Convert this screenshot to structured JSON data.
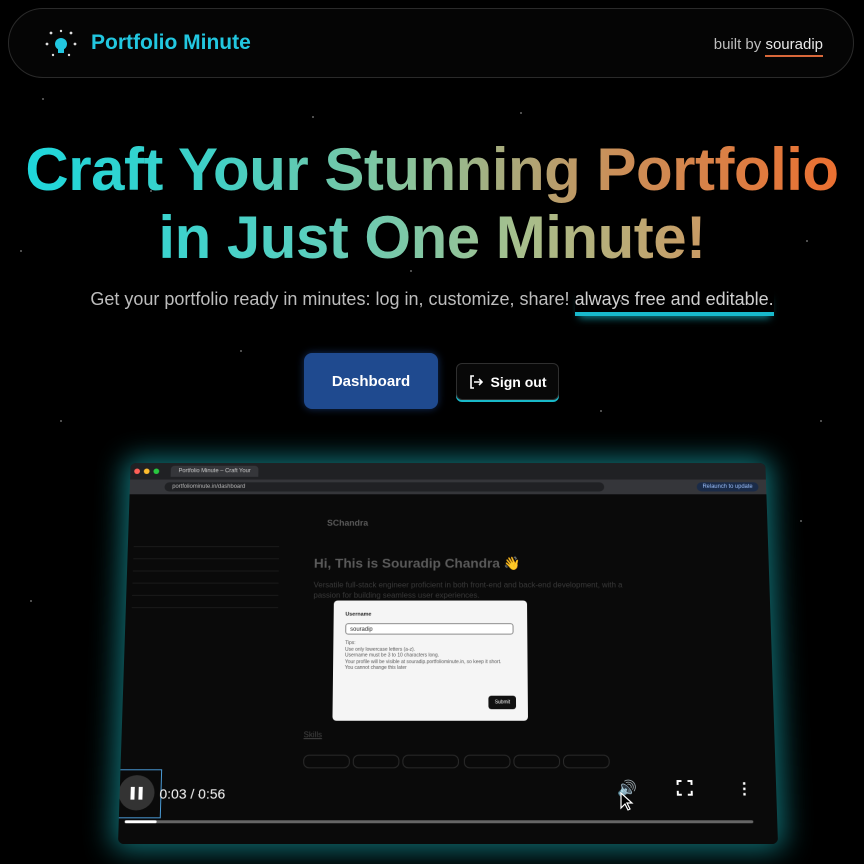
{
  "nav": {
    "brand": "Portfolio Minute",
    "built_prefix": "built by",
    "built_author": "souradip"
  },
  "hero": {
    "line1": "Craft Your Stunning Portfolio",
    "line2": "in Just One Minute!",
    "subtitle": "Get your portfolio ready in minutes: log in, customize, share!",
    "subtitle_highlight": "always free and editable."
  },
  "buttons": {
    "dashboard": "Dashboard",
    "sign_out": "Sign out"
  },
  "video": {
    "tab_title": "Portfolio Minute – Craft Your",
    "url": "portfoliominute.in/dashboard",
    "relaunch": "Relaunch to update",
    "page_name": "SChandra",
    "page_title": "Hi, This is Souradip Chandra 👋",
    "page_text": "Versatile full-stack engineer proficient in both front-end and back-end development, with a passion for building seamless user experiences.",
    "skills_label": "Skills",
    "modal": {
      "label": "Username",
      "value": "souradip",
      "tips_title": "Tips:",
      "tips": [
        "Use only lowercase letters (a-z).",
        "Username must be 3 to 10 characters long.",
        "Your profile will be visible at souradip.portfoliominute.in, so keep it short.",
        "You cannot change this later"
      ],
      "submit": "Submit"
    },
    "time": "0:03 / 0:56",
    "progress": 0.05
  },
  "colors": {
    "accent_cyan": "#18b9cc",
    "accent_orange": "#f06a2a",
    "dashboard_bg": "#1f4a8f"
  }
}
